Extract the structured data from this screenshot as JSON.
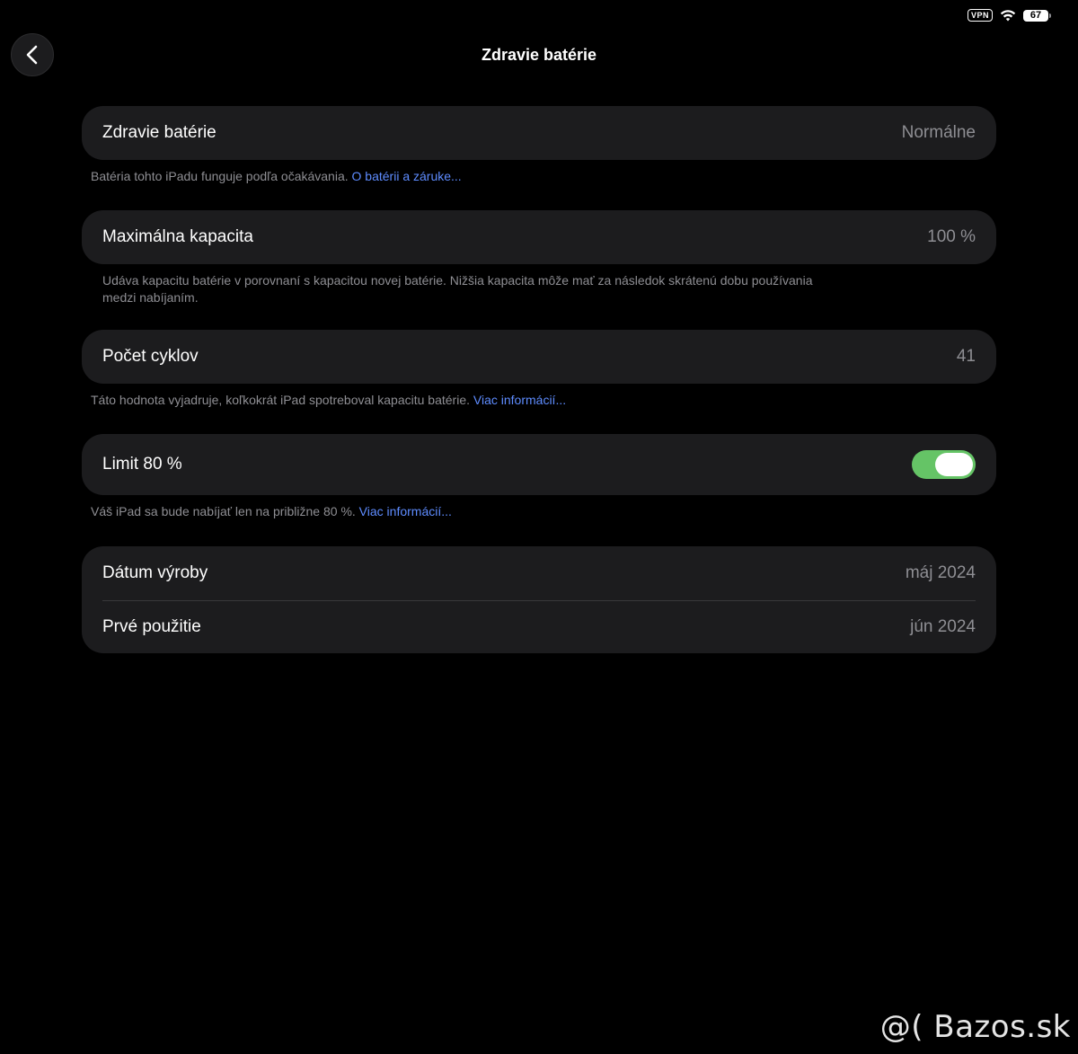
{
  "status_bar": {
    "vpn": "VPN",
    "battery_level": "67"
  },
  "header": {
    "title": "Zdravie batérie",
    "back_icon": "chevron-left-icon"
  },
  "sections": {
    "health": {
      "label": "Zdravie batérie",
      "value": "Normálne",
      "footnote_text": "Batéria tohto iPadu funguje podľa očakávania.",
      "footnote_link": "O batérii a záruke..."
    },
    "capacity": {
      "label": "Maximálna kapacita",
      "value": "100 %",
      "footnote_line1": "Udáva kapacitu batérie v porovnaní s kapacitou novej batérie. Nižšia kapacita môže mať za následok skrátenú dobu používania",
      "footnote_line2": "medzi nabíjaním."
    },
    "cycles": {
      "label": "Počet cyklov",
      "value": "41",
      "footnote_text": "Táto hodnota vyjadruje, koľkokrát iPad spotreboval kapacitu batérie.",
      "footnote_link": "Viac informácií..."
    },
    "limit": {
      "label": "Limit 80 %",
      "toggle_on": true,
      "footnote_text": "Váš iPad sa bude nabíjať len na približne 80 %.",
      "footnote_link": "Viac informácií..."
    },
    "dates": {
      "manufacture_label": "Dátum výroby",
      "manufacture_value": "máj 2024",
      "first_use_label": "Prvé použitie",
      "first_use_value": "jún 2024"
    }
  },
  "watermark": "@( Bazos.sk",
  "colors": {
    "background": "#000000",
    "card": "#1c1c1e",
    "link": "#5e8cff",
    "toggle_on": "#65c466",
    "secondary_text": "#8e8e93"
  }
}
